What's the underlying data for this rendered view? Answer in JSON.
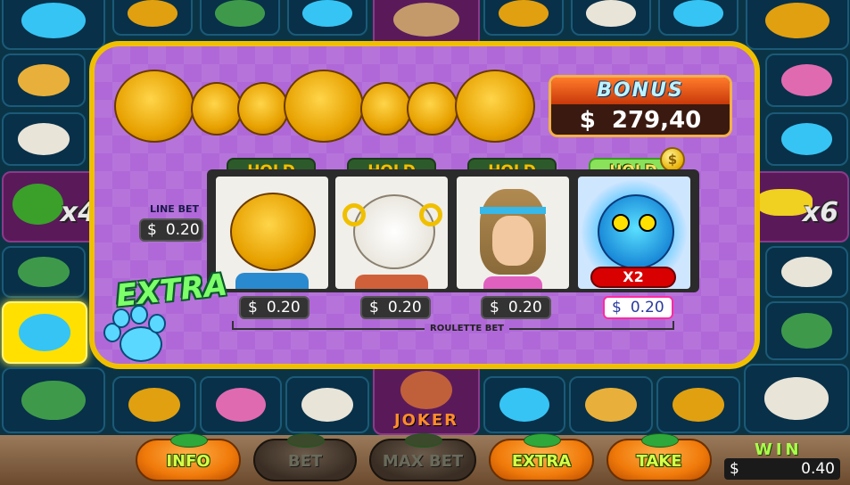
{
  "bonus": {
    "title": "BONUS",
    "currency": "$",
    "amount": "279,40"
  },
  "line_bet": {
    "label": "LINE BET",
    "currency": "$",
    "value": "0.20"
  },
  "holds": [
    {
      "label": "HOLD",
      "active": false
    },
    {
      "label": "HOLD",
      "active": false
    },
    {
      "label": "HOLD",
      "active": false
    },
    {
      "label": "HOLD",
      "active": true
    }
  ],
  "reels": [
    {
      "symbol": "monkey-icon"
    },
    {
      "symbol": "ram-icon"
    },
    {
      "symbol": "hippie-man-icon"
    },
    {
      "symbol": "owl-icon",
      "multiplier": "X2"
    }
  ],
  "reel_bets": [
    {
      "currency": "$",
      "value": "0.20"
    },
    {
      "currency": "$",
      "value": "0.20"
    },
    {
      "currency": "$",
      "value": "0.20"
    },
    {
      "currency": "$",
      "value": "0.20"
    }
  ],
  "roulette_bet_label": "ROULETTE BET",
  "extra_logo": "EXTRA",
  "board": {
    "multipliers": [
      "x4",
      "x6"
    ],
    "joker_label": "JOKER"
  },
  "buttons": [
    {
      "label": "INFO",
      "enabled": true
    },
    {
      "label": "BET",
      "enabled": false
    },
    {
      "label": "MAX BET",
      "enabled": false
    },
    {
      "label": "EXTRA",
      "enabled": true
    },
    {
      "label": "TAKE",
      "enabled": true
    }
  ],
  "win": {
    "label": "WIN",
    "currency": "$",
    "value": "0.40"
  },
  "colors": {
    "panel": "#b068d8",
    "frame": "#f0c000",
    "board": "#0a3446",
    "highlight": "#ffe000"
  }
}
